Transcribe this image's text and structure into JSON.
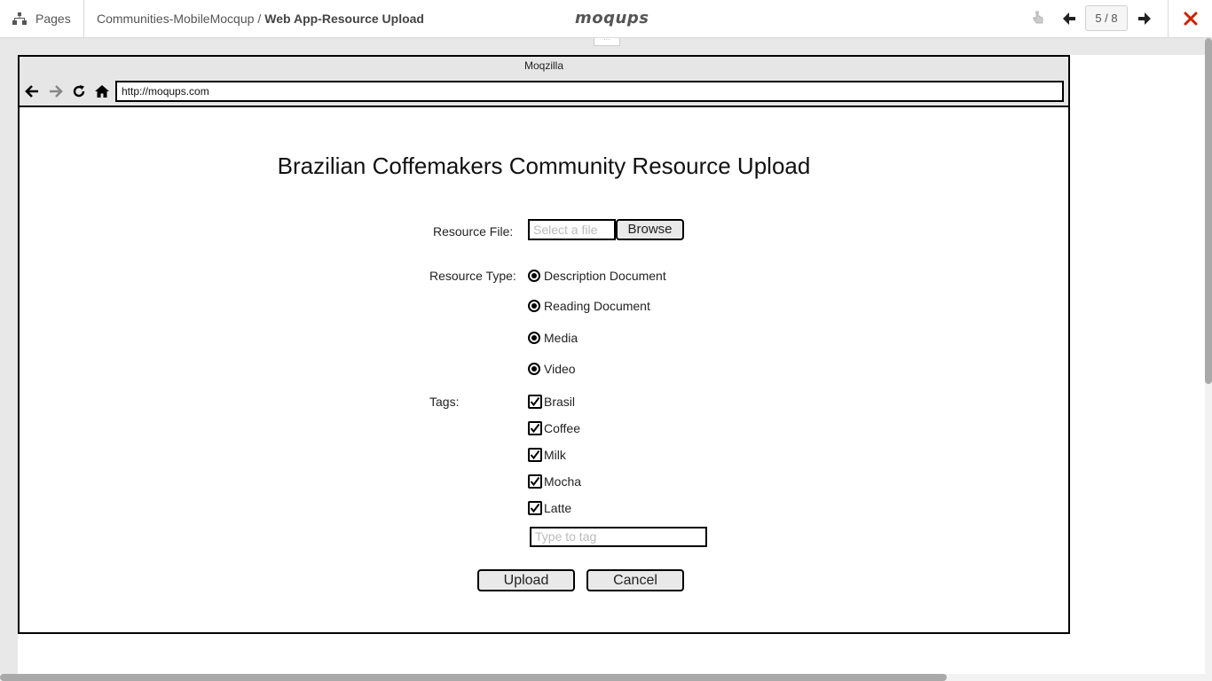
{
  "topbar": {
    "pages_label": "Pages",
    "project_name": "Communities-MobileMocqup",
    "separator": "/",
    "page_name": "Web App-Resource Upload",
    "logo": "moqups",
    "page_counter": "5 / 8",
    "icons": {
      "pages": "sitemap-icon",
      "interaction": "hand-pointer-icon",
      "prev": "arrow-left-icon",
      "next": "arrow-right-icon",
      "close": "close-icon"
    },
    "close_color": "#cc2200"
  },
  "browser": {
    "title": "Moqzilla",
    "url": "http://moqups.com",
    "nav_icons": [
      "back-arrow-icon",
      "forward-arrow-icon",
      "refresh-icon",
      "home-icon"
    ]
  },
  "form": {
    "heading": "Brazilian Coffemakers Community Resource Upload",
    "resource_file_label": "Resource File:",
    "file_placeholder": "Select a file",
    "browse_label": "Browse",
    "resource_type_label": "Resource Type:",
    "resource_types": [
      {
        "label": "Description Document",
        "selected": true
      },
      {
        "label": "Reading Document",
        "selected": true
      },
      {
        "label": "Media",
        "selected": true
      },
      {
        "label": "Video",
        "selected": true
      }
    ],
    "tags_label": "Tags:",
    "tags": [
      {
        "label": "Brasil",
        "checked": true
      },
      {
        "label": "Coffee",
        "checked": true
      },
      {
        "label": "Milk",
        "checked": true
      },
      {
        "label": "Mocha",
        "checked": true
      },
      {
        "label": "Latte",
        "checked": true
      }
    ],
    "tag_placeholder": "Type to tag",
    "upload_label": "Upload",
    "cancel_label": "Cancel"
  }
}
